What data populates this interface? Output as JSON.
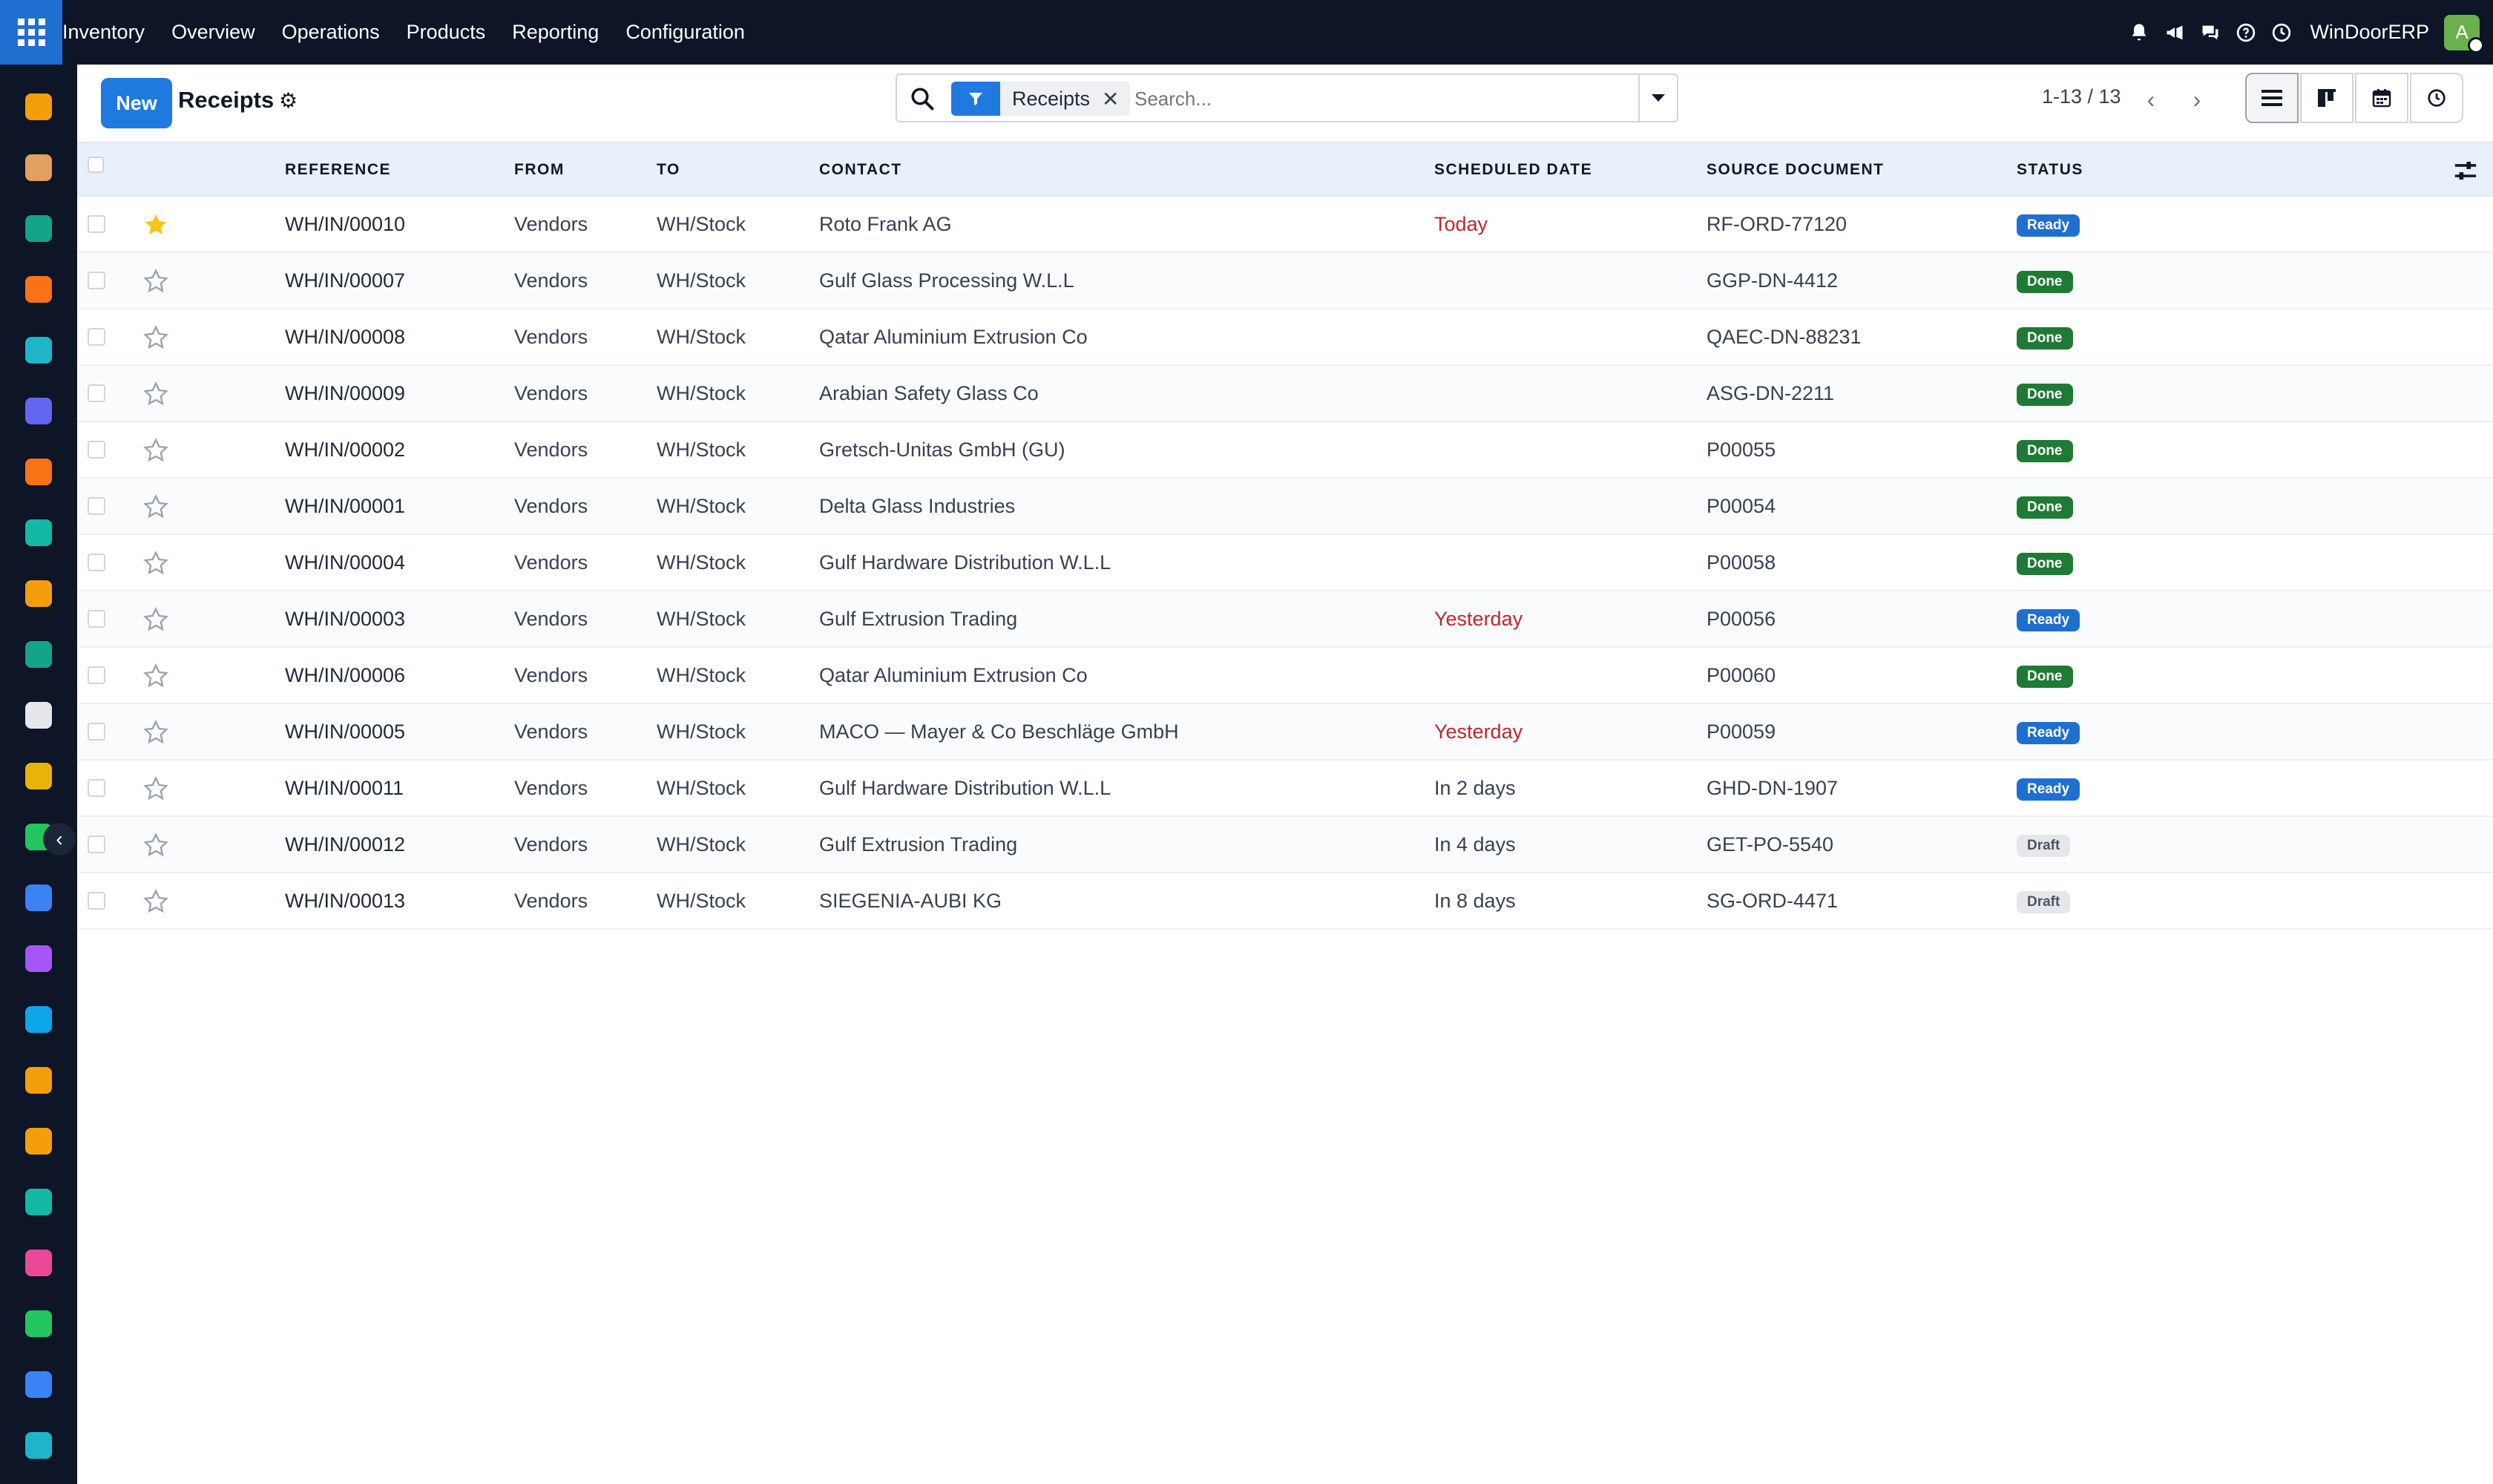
{
  "navbar": {
    "app_name": "Inventory",
    "menu": [
      "Overview",
      "Operations",
      "Products",
      "Reporting",
      "Configuration"
    ],
    "company": "WinDoorERP",
    "avatar_initial": "A",
    "icons": [
      "bell-icon",
      "megaphone-icon",
      "chat-icon",
      "help-icon",
      "clock-icon"
    ]
  },
  "dock": {
    "apps": [
      {
        "name": "sales-app-icon",
        "color": "#f59e0b"
      },
      {
        "name": "studio-app-icon",
        "color": "#e0a060"
      },
      {
        "name": "contacts-app-icon",
        "color": "#14a38b"
      },
      {
        "name": "discuss-app-icon",
        "color": "#f97316"
      },
      {
        "name": "website-app-icon",
        "color": "#1fb5c9"
      },
      {
        "name": "email-marketing-app-icon",
        "color": "#6366f1"
      },
      {
        "name": "live-chat-app-icon",
        "color": "#f97316"
      },
      {
        "name": "inventory-app-icon",
        "color": "#14b8a6"
      },
      {
        "name": "reporting-app-icon",
        "color": "#f59e0b"
      },
      {
        "name": "employees-app-icon",
        "color": "#14a38b"
      },
      {
        "name": "cube-app-icon",
        "color": "#e5e7eb"
      },
      {
        "name": "studio2-app-icon",
        "color": "#eab308"
      },
      {
        "name": "project-app-icon",
        "color": "#22c55e"
      },
      {
        "name": "knowledge-app-icon",
        "color": "#3b82f6"
      },
      {
        "name": "repair-app-icon",
        "color": "#a855f7"
      },
      {
        "name": "invoicing-app-icon",
        "color": "#0ea5e9"
      },
      {
        "name": "team-app-icon",
        "color": "#f59e0b"
      },
      {
        "name": "calendar-app-icon",
        "color": "#f59e0b"
      },
      {
        "name": "sign-app-icon",
        "color": "#14b8a6"
      },
      {
        "name": "dashboard-app-icon",
        "color": "#ec4899"
      },
      {
        "name": "whatsapp-app-icon",
        "color": "#22c55e"
      },
      {
        "name": "timer-app-icon",
        "color": "#3b82f6"
      },
      {
        "name": "website2-app-icon",
        "color": "#1fb5c9"
      }
    ],
    "collapse_glyph": "‹"
  },
  "control_panel": {
    "new_label": "New",
    "title": "Receipts",
    "gear_glyph": "⚙",
    "facet_label": "Receipts",
    "facet_remove_glyph": "✕",
    "search_placeholder": "Search...",
    "pager": "1-13 / 13",
    "prev_glyph": "‹",
    "next_glyph": "›",
    "views": [
      "list-view",
      "kanban-view",
      "calendar-view",
      "activity-view"
    ],
    "active_view": "list-view"
  },
  "table": {
    "columns": [
      "REFERENCE",
      "FROM",
      "TO",
      "CONTACT",
      "SCHEDULED DATE",
      "SOURCE DOCUMENT",
      "STATUS"
    ],
    "rows": [
      {
        "ref": "WH/IN/00010",
        "from": "Vendors",
        "to": "WH/Stock",
        "contact": "Roto Frank AG",
        "date": "Today",
        "date_red": true,
        "source": "RF-ORD-77120",
        "status": "Ready",
        "starred": true
      },
      {
        "ref": "WH/IN/00007",
        "from": "Vendors",
        "to": "WH/Stock",
        "contact": "Gulf Glass Processing W.L.L",
        "date": "",
        "date_red": false,
        "source": "GGP-DN-4412",
        "status": "Done",
        "starred": false
      },
      {
        "ref": "WH/IN/00008",
        "from": "Vendors",
        "to": "WH/Stock",
        "contact": "Qatar Aluminium Extrusion Co",
        "date": "",
        "date_red": false,
        "source": "QAEC-DN-88231",
        "status": "Done",
        "starred": false
      },
      {
        "ref": "WH/IN/00009",
        "from": "Vendors",
        "to": "WH/Stock",
        "contact": "Arabian Safety Glass Co",
        "date": "",
        "date_red": false,
        "source": "ASG-DN-2211",
        "status": "Done",
        "starred": false
      },
      {
        "ref": "WH/IN/00002",
        "from": "Vendors",
        "to": "WH/Stock",
        "contact": "Gretsch-Unitas GmbH (GU)",
        "date": "",
        "date_red": false,
        "source": "P00055",
        "status": "Done",
        "starred": false
      },
      {
        "ref": "WH/IN/00001",
        "from": "Vendors",
        "to": "WH/Stock",
        "contact": "Delta Glass Industries",
        "date": "",
        "date_red": false,
        "source": "P00054",
        "status": "Done",
        "starred": false
      },
      {
        "ref": "WH/IN/00004",
        "from": "Vendors",
        "to": "WH/Stock",
        "contact": "Gulf Hardware Distribution W.L.L",
        "date": "",
        "date_red": false,
        "source": "P00058",
        "status": "Done",
        "starred": false
      },
      {
        "ref": "WH/IN/00003",
        "from": "Vendors",
        "to": "WH/Stock",
        "contact": "Gulf Extrusion Trading",
        "date": "Yesterday",
        "date_red": true,
        "source": "P00056",
        "status": "Ready",
        "starred": false
      },
      {
        "ref": "WH/IN/00006",
        "from": "Vendors",
        "to": "WH/Stock",
        "contact": "Qatar Aluminium Extrusion Co",
        "date": "",
        "date_red": false,
        "source": "P00060",
        "status": "Done",
        "starred": false
      },
      {
        "ref": "WH/IN/00005",
        "from": "Vendors",
        "to": "WH/Stock",
        "contact": "MACO — Mayer & Co Beschläge GmbH",
        "date": "Yesterday",
        "date_red": true,
        "source": "P00059",
        "status": "Ready",
        "starred": false
      },
      {
        "ref": "WH/IN/00011",
        "from": "Vendors",
        "to": "WH/Stock",
        "contact": "Gulf Hardware Distribution W.L.L",
        "date": "In 2 days",
        "date_red": false,
        "source": "GHD-DN-1907",
        "status": "Ready",
        "starred": false
      },
      {
        "ref": "WH/IN/00012",
        "from": "Vendors",
        "to": "WH/Stock",
        "contact": "Gulf Extrusion Trading",
        "date": "In 4 days",
        "date_red": false,
        "source": "GET-PO-5540",
        "status": "Draft",
        "starred": false
      },
      {
        "ref": "WH/IN/00013",
        "from": "Vendors",
        "to": "WH/Stock",
        "contact": "SIEGENIA-AUBI KG",
        "date": "In 8 days",
        "date_red": false,
        "source": "SG-ORD-4471",
        "status": "Draft",
        "starred": false
      }
    ]
  },
  "colors": {
    "navbar_bg": "#0d1526",
    "primary": "#1f7ae0",
    "status_ready": "#1f6fd1",
    "status_done": "#1e7a34",
    "status_draft": "#e5e7eb",
    "overdue_text": "#c0262d",
    "star_active": "#f5c518"
  }
}
